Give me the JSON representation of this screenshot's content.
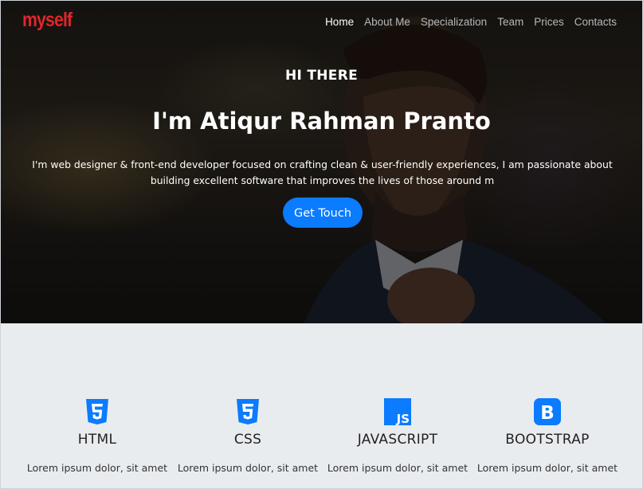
{
  "nav": {
    "logo": "myself",
    "items": [
      {
        "label": "Home",
        "active": true
      },
      {
        "label": "About Me"
      },
      {
        "label": "Specialization"
      },
      {
        "label": "Team"
      },
      {
        "label": "Prices"
      },
      {
        "label": "Contacts"
      }
    ]
  },
  "hero": {
    "greeting": "HI THERE",
    "name": "I'm Atiqur Rahman Pranto",
    "description": "I'm web designer & front-end developer focused on crafting clean & user-friendly experiences, I am passionate about building excellent software that improves the lives of those around m",
    "cta_label": "Get Touch"
  },
  "skills": [
    {
      "icon": "html5-icon",
      "title": "HTML",
      "text": "Lorem ipsum dolor, sit amet"
    },
    {
      "icon": "css3-icon",
      "title": "CSS",
      "text": "Lorem ipsum dolor, sit amet"
    },
    {
      "icon": "javascript-icon",
      "title": "JAVASCRIPT",
      "text": "Lorem ipsum dolor, sit amet"
    },
    {
      "icon": "bootstrap-icon",
      "title": "BOOTSTRAP",
      "text": "Lorem ipsum dolor, sit amet"
    }
  ],
  "colors": {
    "logo": "#e0252a",
    "accent": "#0b7bff",
    "section_bg": "#e9ecef"
  }
}
